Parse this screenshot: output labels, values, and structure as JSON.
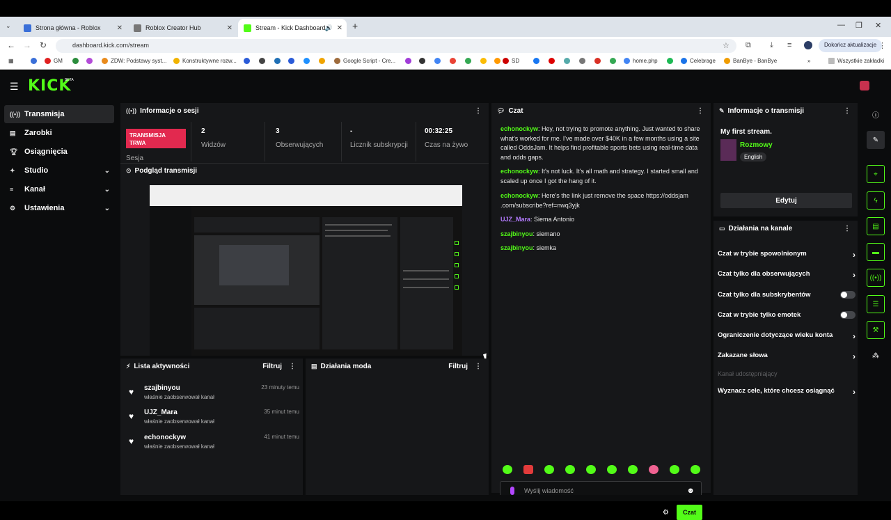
{
  "browser": {
    "tabs": [
      {
        "title": "Strona główna - Roblox"
      },
      {
        "title": "Roblox Creator Hub"
      },
      {
        "title": "Stream - Kick Dashboard"
      }
    ],
    "url": "dashboard.kick.com/stream",
    "update_button": "Dokończ aktualizacje",
    "bookmarks": [
      "GM",
      "ZDW: Podstawy syst...",
      "Konstruktywne rozw...",
      "Google Script - Cre...",
      "SD",
      "home.php",
      "Celebrage",
      "BanBye - BanBye"
    ],
    "all_bookmarks": "Wszystkie zakładki"
  },
  "app": {
    "logo": "KICK",
    "logo_badge": "BETA",
    "nav": [
      {
        "label": "Transmisja",
        "icon": "broadcast-icon"
      },
      {
        "label": "Zarobki",
        "icon": "earnings-icon"
      },
      {
        "label": "Osiągnięcia",
        "icon": "trophy-icon"
      },
      {
        "label": "Studio",
        "icon": "studio-icon"
      },
      {
        "label": "Kanał",
        "icon": "channel-icon"
      },
      {
        "label": "Ustawienia",
        "icon": "settings-icon"
      }
    ]
  },
  "session": {
    "title": "Informacje o sesji",
    "badge": "TRANSMISJA TRWA",
    "badge_sub": "Sesja",
    "viewers": "2",
    "viewers_label": "Widzów",
    "followers": "3",
    "followers_label": "Obserwujących",
    "subs": "-",
    "subs_label": "Licznik subskrypcji",
    "uptime": "00:32:25",
    "uptime_label": "Czas na żywo"
  },
  "preview": {
    "title": "Podgląd transmisji"
  },
  "activity": {
    "title": "Lista aktywności",
    "filter": "Filtruj",
    "items": [
      {
        "user": "szajbinyou",
        "desc": "właśnie zaobserwował kanał",
        "time": "23 minuty temu"
      },
      {
        "user": "UJZ_Mara",
        "desc": "właśnie zaobserwował kanał",
        "time": "35 minut temu"
      },
      {
        "user": "echonockyw",
        "desc": "właśnie zaobserwował kanał",
        "time": "41 minut temu"
      }
    ]
  },
  "modactions": {
    "title": "Działania moda",
    "filter": "Filtruj"
  },
  "chat": {
    "title": "Czat",
    "messages": [
      {
        "user": "echonockyw",
        "text": "Hey, not trying to promote anything. Just wanted to share what's worked for me. I've made over $40K in a few months using a site called OddsJam. It helps find profitable sports bets using real-time data and odds gaps."
      },
      {
        "user": "echonockyw",
        "text": "It's not luck. It's all math and strategy. I started small and scaled up once I got the hang of it."
      },
      {
        "user": "echonockyw",
        "text": "Here's the link just remove the space https://oddsjam .com/subscribe?ref=nwq3yjk"
      },
      {
        "user": "UJZ_Mara",
        "text": "Siema Antonio"
      },
      {
        "user": "szajbinyou",
        "text": "siemano"
      },
      {
        "user": "szajbinyou",
        "text": "siemka"
      }
    ],
    "placeholder": "Wyślij wiadomość",
    "send": "Czat"
  },
  "stream_info": {
    "title": "Informacje o transmisji",
    "stream_title": "My first stream.",
    "category": "Rozmowy",
    "language": "English",
    "edit": "Edytuj"
  },
  "channel_actions": {
    "title": "Działania na kanale",
    "items": [
      {
        "label": "Czat w trybie spowolnionym",
        "control": "chevron"
      },
      {
        "label": "Czat tylko dla obserwujących",
        "control": "chevron"
      },
      {
        "label": "Czat tylko dla subskrybentów",
        "control": "toggle"
      },
      {
        "label": "Czat w trybie tylko emotek",
        "control": "toggle"
      },
      {
        "label": "Ograniczenie dotyczące wieku konta",
        "control": "chevron"
      },
      {
        "label": "Zakazane słowa",
        "control": "chevron"
      },
      {
        "label": "Kanał udostępniający",
        "control": "disabled"
      },
      {
        "label": "Wyznacz cele, które chcesz osiągnąć",
        "control": "chevron"
      }
    ]
  },
  "colors": {
    "accent": "#53fc18",
    "live": "#e2294f",
    "panel": "#161719",
    "bg": "#0b0c0d"
  }
}
